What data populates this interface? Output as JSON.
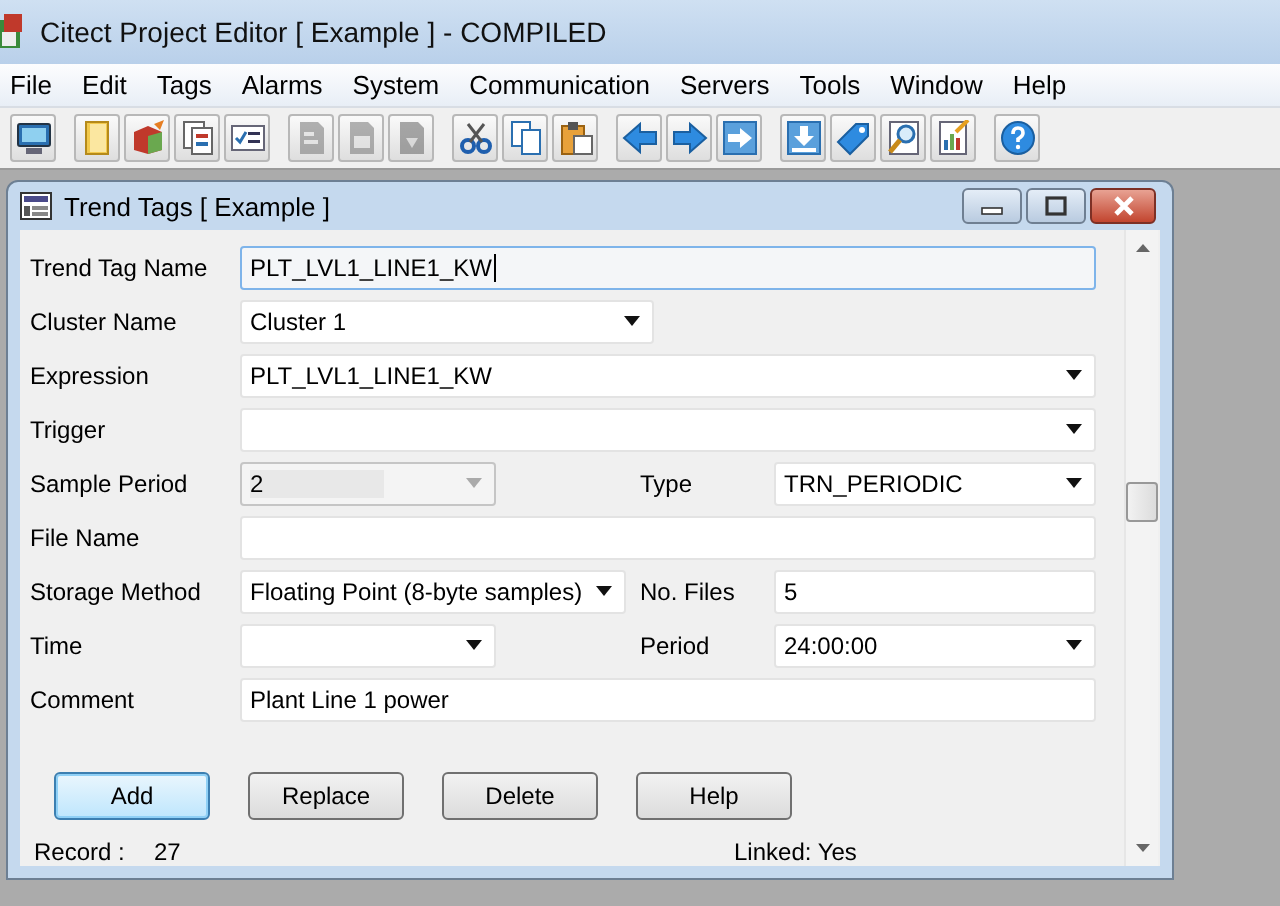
{
  "window": {
    "title": "Citect Project Editor [ Example ] - COMPILED"
  },
  "menu": [
    "File",
    "Edit",
    "Tags",
    "Alarms",
    "System",
    "Communication",
    "Servers",
    "Tools",
    "Window",
    "Help"
  ],
  "toolbar": [
    {
      "disabled": false
    },
    {
      "disabled": false
    },
    {
      "disabled": false
    },
    {
      "disabled": false
    },
    {
      "disabled": false
    },
    {
      "disabled": true
    },
    {
      "disabled": true
    },
    {
      "disabled": true
    },
    {
      "disabled": false
    },
    {
      "disabled": false
    },
    {
      "disabled": false
    },
    {
      "disabled": false
    },
    {
      "disabled": false
    },
    {
      "disabled": false
    },
    {
      "disabled": false
    },
    {
      "disabled": false
    },
    {
      "disabled": false
    },
    {
      "disabled": false
    },
    {
      "disabled": false
    }
  ],
  "dialog": {
    "title": "Trend Tags [ Example ]",
    "rows": [
      {
        "fields": [
          {
            "label": "Trend Tag Name",
            "kind": "text",
            "value": "PLT_LVL1_LINE1_KW",
            "focused": true,
            "disabled": false
          }
        ]
      },
      {
        "fields": [
          {
            "label": "Cluster Name",
            "kind": "combo",
            "value": "Cluster 1",
            "focused": false,
            "disabled": false
          }
        ]
      },
      {
        "fields": [
          {
            "label": "Expression",
            "kind": "combo",
            "value": "PLT_LVL1_LINE1_KW",
            "focused": false,
            "disabled": false
          }
        ]
      },
      {
        "fields": [
          {
            "label": "Trigger",
            "kind": "combo",
            "focused": false,
            "disabled": false
          }
        ]
      },
      {
        "fields": [
          {
            "label": "Sample Period",
            "kind": "combo",
            "value": "2",
            "focused": false,
            "disabled": true
          },
          {
            "label": "Type",
            "kind": "combo",
            "value": "TRN_PERIODIC",
            "focused": false,
            "disabled": false
          }
        ]
      },
      {
        "fields": [
          {
            "label": "File Name",
            "kind": "text",
            "focused": false,
            "disabled": false
          }
        ]
      },
      {
        "fields": [
          {
            "label": "Storage Method",
            "kind": "combo",
            "value": "Floating Point (8-byte samples)",
            "focused": false,
            "disabled": false
          },
          {
            "label": "No. Files",
            "kind": "text",
            "value": "5",
            "focused": false,
            "disabled": false
          }
        ]
      },
      {
        "fields": [
          {
            "label": "Time",
            "kind": "combo",
            "focused": false,
            "disabled": false
          },
          {
            "label": "Period",
            "kind": "combo",
            "value": "24:00:00",
            "focused": false,
            "disabled": false
          }
        ]
      },
      {
        "fields": [
          {
            "label": "Comment",
            "kind": "text",
            "value": "Plant Line 1 power",
            "focused": false,
            "disabled": false
          }
        ]
      }
    ],
    "buttons": [
      {
        "label": "Add",
        "default": true
      },
      {
        "label": "Replace",
        "default": false
      },
      {
        "label": "Delete",
        "default": false
      },
      {
        "label": "Help",
        "default": false
      }
    ],
    "status": {
      "record_label": "Record :",
      "record": "27",
      "linked": "Linked: Yes"
    }
  }
}
